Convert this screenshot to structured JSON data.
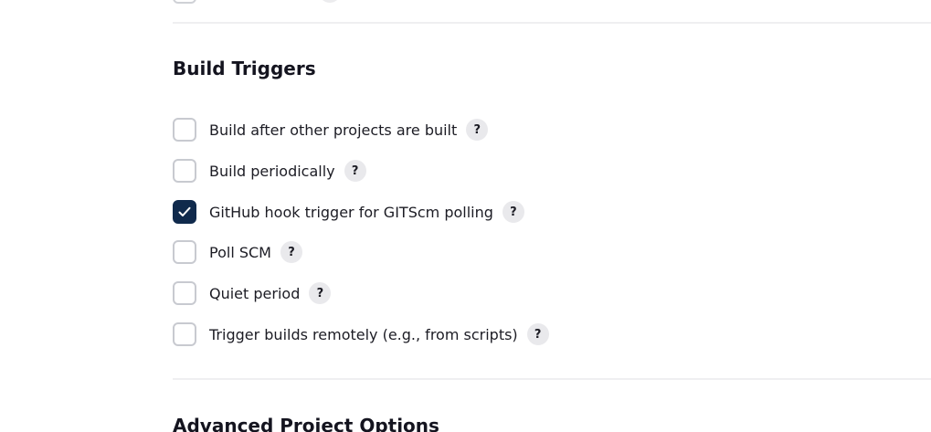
{
  "build_triggers": {
    "title": "Build Triggers",
    "help_glyph": "?",
    "options": [
      {
        "label": "Build after other projects are built",
        "checked": false
      },
      {
        "label": "Build periodically",
        "checked": false
      },
      {
        "label": "GitHub hook trigger for GITScm polling",
        "checked": true
      },
      {
        "label": "Poll SCM",
        "checked": false
      },
      {
        "label": "Quiet period",
        "checked": false
      },
      {
        "label": "Trigger builds remotely (e.g., from scripts)",
        "checked": false
      }
    ]
  },
  "advanced_project_options": {
    "title": "Advanced Project Options"
  },
  "colors": {
    "checked_fill": "#102a4c",
    "checkbox_border": "#c8cad0",
    "help_bg": "#e9e9ec",
    "divider": "#efeff1"
  }
}
